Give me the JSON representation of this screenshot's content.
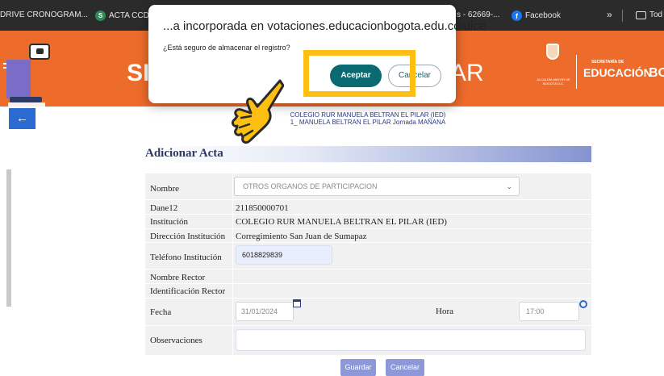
{
  "bookmarks": {
    "items": [
      {
        "label": "DRIVE CRONOGRAM...",
        "icon": "none"
      },
      {
        "label": "ACTA CCDP",
        "icon": "s-icon"
      },
      {
        "label": "s - 62669-...",
        "icon": "none"
      },
      {
        "label": "Facebook",
        "icon": "facebook-icon"
      },
      {
        "label": "»",
        "icon": "none"
      },
      {
        "label": "Tod",
        "icon": "folder-icon"
      }
    ]
  },
  "header": {
    "left_text": "SI",
    "right_text": "AR",
    "secretaria_small": "SECRETARÍA DE",
    "secretaria_big": "EDUCACIÓN",
    "bo_text": "BO",
    "shield_caption": "ALCALDÍA MAYOR DE BOGOTÁ D.C.",
    "brand_color": "#ee6c2b"
  },
  "institution": {
    "line1": "COLEGIO RUR MANUELA BELTRAN EL PILAR (IED)",
    "line2": "1_ MANUELA BELTRAN EL PILAR    Jornada MAÑANA"
  },
  "form": {
    "title": "Adicionar Acta",
    "labels": {
      "nombre": "Nombre",
      "dane": "Dane12",
      "institucion": "Institución",
      "direccion": "Dirección Institución",
      "telefono": "Teléfono Institución",
      "rector": "Nombre Rector",
      "identificacion": "Identificación Rector",
      "fecha": "Fecha",
      "hora": "Hora",
      "observaciones": "Observaciones"
    },
    "values": {
      "nombre_selected": "OTROS ORGANOS DE PARTICIPACION",
      "dane": "211850000701",
      "institucion": "COLEGIO RUR MANUELA BELTRAN EL PILAR (IED)",
      "direccion": "Corregimiento San Juan de Sumapaz",
      "telefono": "6018829839",
      "fecha": "31/01/2024",
      "hora": "17:00"
    },
    "buttons": {
      "guardar": "Guardar",
      "cancelar": "Cancelar"
    }
  },
  "dialog": {
    "title": "...a incorporada en votaciones.educacionbogota.edu.co dice",
    "message": "¿Está seguro de almacenar el registro?",
    "accept_label": "Aceptar",
    "cancel_label": "Cancelar",
    "accent_color": "#0b6a71",
    "highlight_color": "#fcbf12"
  }
}
